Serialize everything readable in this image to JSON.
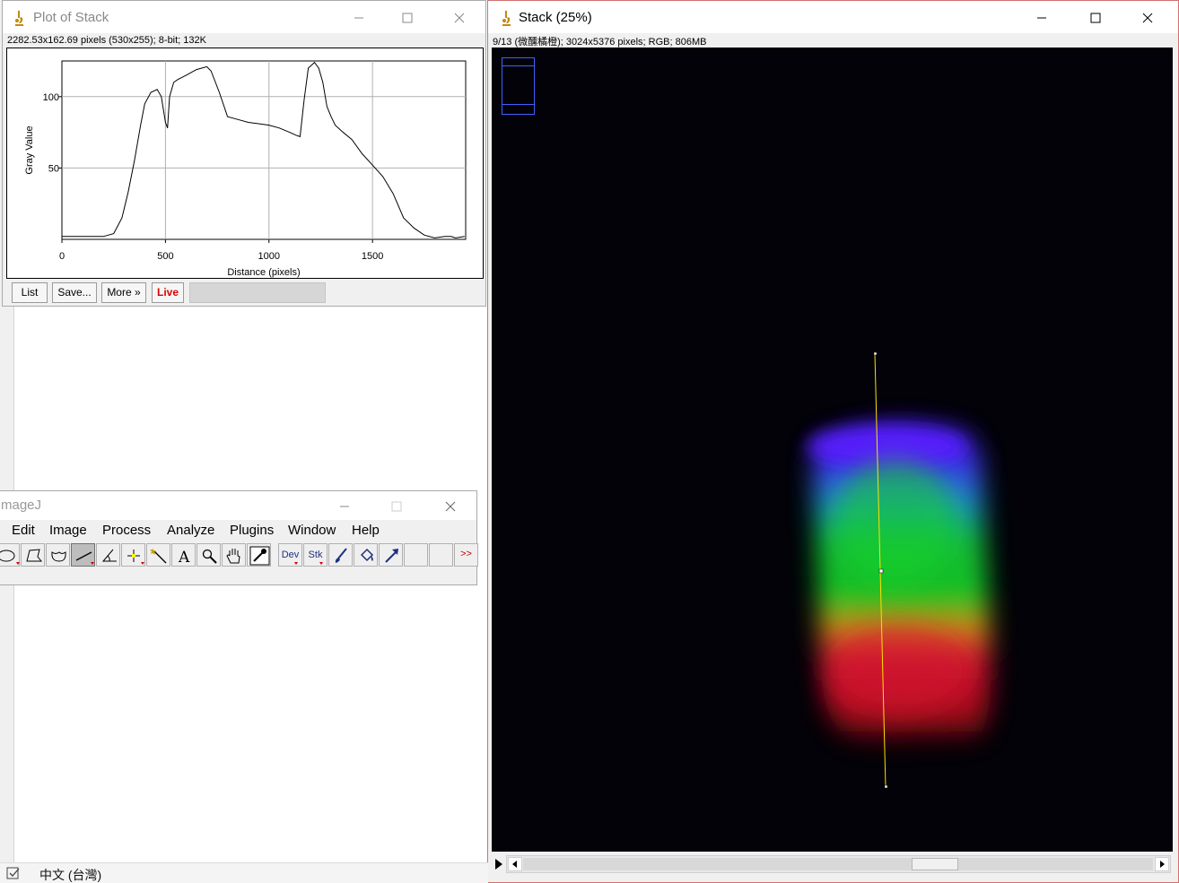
{
  "plot_window": {
    "title": "Plot of Stack",
    "info": "2282.53x162.69 pixels (530x255); 8-bit; 132K",
    "buttons": {
      "list": "List",
      "save": "Save...",
      "more": "More »",
      "live": "Live"
    }
  },
  "chart_data": {
    "type": "line",
    "title": "",
    "xlabel": "Distance (pixels)",
    "ylabel": "Gray Value",
    "xlim": [
      0,
      1950
    ],
    "ylim": [
      0,
      125
    ],
    "x_ticks": [
      "0",
      "500",
      "1000",
      "1500"
    ],
    "y_ticks": [
      "50",
      "100"
    ],
    "grid": true,
    "series": [
      {
        "x": [
          0,
          100,
          200,
          250,
          290,
          320,
          350,
          380,
          400,
          430,
          460,
          480,
          500,
          510,
          520,
          540,
          560,
          600,
          650,
          700,
          720,
          760,
          800,
          850,
          900,
          950,
          1000,
          1050,
          1100,
          1130,
          1150,
          1170,
          1190,
          1220,
          1240,
          1260,
          1280,
          1300,
          1320,
          1350,
          1400,
          1450,
          1500,
          1550,
          1600,
          1650,
          1700,
          1750,
          1800,
          1850,
          1880,
          1900,
          1945
        ],
        "y": [
          2,
          2,
          2,
          4,
          15,
          33,
          55,
          80,
          95,
          103,
          105,
          100,
          82,
          78,
          100,
          110,
          112,
          115,
          119,
          121,
          118,
          103,
          86,
          84,
          82,
          81,
          80,
          78,
          75,
          73,
          72,
          98,
          120,
          124,
          120,
          110,
          93,
          86,
          80,
          76,
          70,
          60,
          52,
          44,
          32,
          15,
          8,
          3,
          1,
          2,
          2,
          1,
          2
        ]
      }
    ]
  },
  "stack_window": {
    "title": "Stack (25%)",
    "info": "9/13 (微醺橘橙); 3024x5376 pixels; RGB; 806MB"
  },
  "imagej_window": {
    "title": "mageJ",
    "menus": [
      "Edit",
      "Image",
      "Process",
      "Analyze",
      "Plugins",
      "Window",
      "Help"
    ],
    "toolbar_text": {
      "dev": "Dev",
      "stk": "Stk",
      "overflow": ">>"
    }
  },
  "taskbar": {
    "language": "中文 (台灣)"
  },
  "colors": {
    "selection_line": "#ffe000",
    "navigator": "#4060ff",
    "live_button": "#e00000"
  }
}
